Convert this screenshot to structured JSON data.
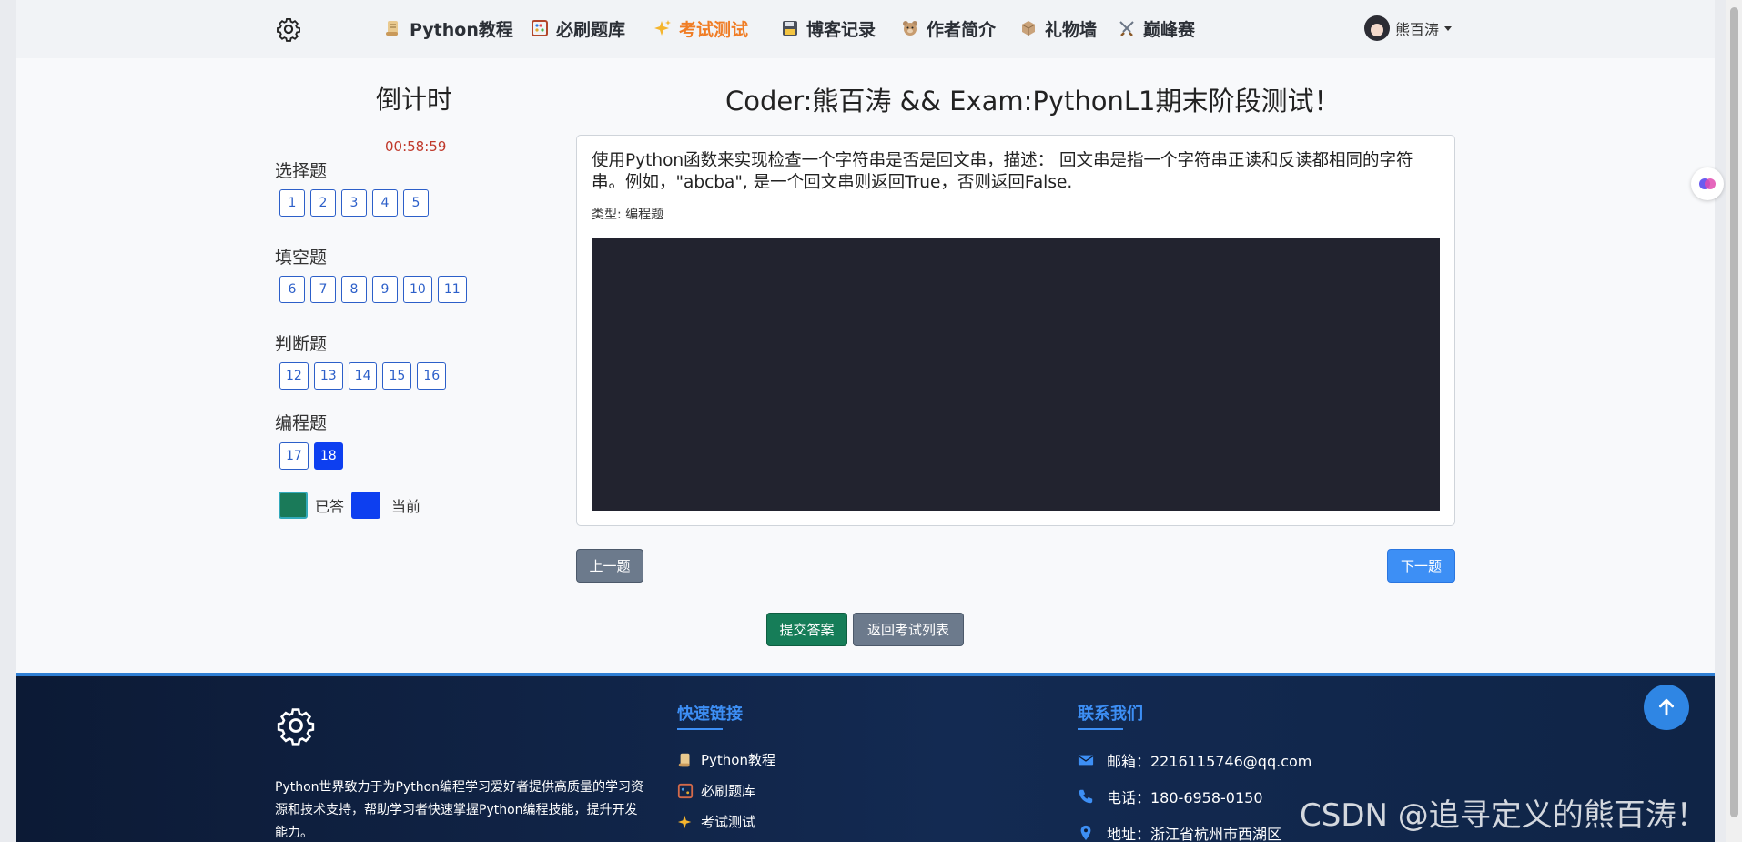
{
  "nav": {
    "items": [
      {
        "label": "Python教程",
        "icon": "scroll-icon",
        "active": false
      },
      {
        "label": "必刷题库",
        "icon": "abacus-icon",
        "active": false
      },
      {
        "label": "考试测试",
        "icon": "sparkles-icon",
        "active": true
      },
      {
        "label": "博客记录",
        "icon": "floppy-disk-icon",
        "active": false
      },
      {
        "label": "作者简介",
        "icon": "bear-face-icon",
        "active": false
      },
      {
        "label": "礼物墙",
        "icon": "package-icon",
        "active": false
      },
      {
        "label": "巅峰赛",
        "icon": "crossed-swords-icon",
        "active": false
      }
    ],
    "user_name": "熊百涛",
    "active_color": "#f07c24"
  },
  "sidebar": {
    "title": "倒计时",
    "timer": "00:58:59",
    "sections": [
      {
        "title": "选择题",
        "questions": [
          "1",
          "2",
          "3",
          "4",
          "5"
        ]
      },
      {
        "title": "填空题",
        "questions": [
          "6",
          "7",
          "8",
          "9",
          "10",
          "11"
        ]
      },
      {
        "title": "判断题",
        "questions": [
          "12",
          "13",
          "14",
          "15",
          "16"
        ]
      },
      {
        "title": "编程题",
        "questions": [
          "17",
          "18"
        ]
      }
    ],
    "current_question": "18",
    "legend": {
      "answered": "已答",
      "current": "当前"
    }
  },
  "main": {
    "title": "Coder:熊百涛 && Exam:PythonL1期末阶段测试！",
    "question_text": "使用Python函数来实现检查一个字符串是否是回文串，描述： 回文串是指一个字符串正读和反读都相同的字符串。例如，\"abcba\", 是一个回文串则返回True，否则返回False.",
    "question_type": "类型: 编程题",
    "prev_label": "上一题",
    "next_label": "下一题",
    "submit_label": "提交答案",
    "back_label": "返回考试列表"
  },
  "footer": {
    "description": "Python世界致力于为Python编程学习爱好者提供高质量的学习资源和技术支持，帮助学习者快速掌握Python编程技能，提升开发能力。",
    "quick_links_title": "快速链接",
    "quick_links": [
      "Python教程",
      "必刷题库",
      "考试测试"
    ],
    "contact_title": "联系我们",
    "contacts": [
      {
        "icon": "envelope-icon",
        "text": "邮箱：2216115746@qq.com"
      },
      {
        "icon": "phone-icon",
        "text": "电话：180-6958-0150"
      },
      {
        "icon": "map-pin-icon",
        "text": "地址：浙江省杭州市西湖区"
      }
    ]
  },
  "watermark": "CSDN @追寻定义的熊百涛！",
  "colors": {
    "accent": "#3d8ff5",
    "current": "#0d3ff0",
    "answered": "#1a7a59",
    "submit": "#167d58",
    "footer_bg": "#0c1a35"
  }
}
